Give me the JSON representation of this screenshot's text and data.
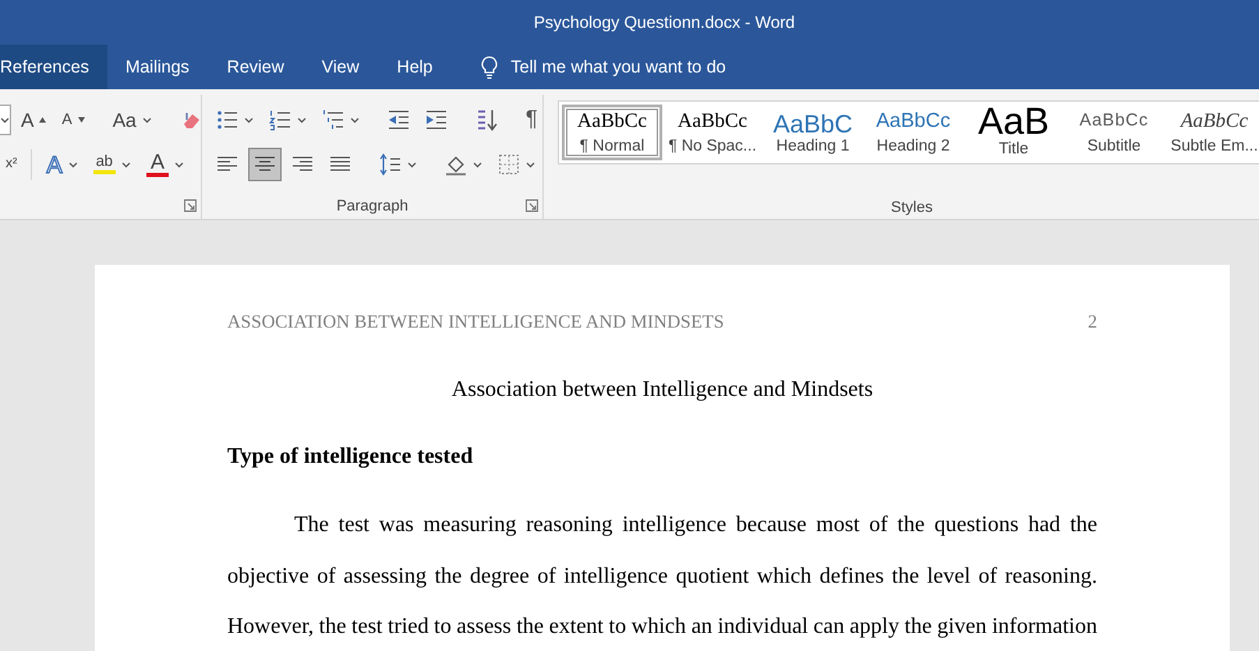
{
  "window": {
    "title": "Psychology Questionn.docx  -  Word"
  },
  "tabs": [
    {
      "label": "References",
      "selected": true
    },
    {
      "label": "Mailings",
      "selected": false
    },
    {
      "label": "Review",
      "selected": false
    },
    {
      "label": "View",
      "selected": false
    },
    {
      "label": "Help",
      "selected": false
    }
  ],
  "tell_me": {
    "placeholder": "Tell me what you want to do"
  },
  "ribbon": {
    "font_group": {
      "rows": [
        [
          {
            "kind": "stub",
            "dropdown": true
          },
          {
            "kind": "glyph",
            "glyph": "A",
            "dropdown": false
          },
          {
            "kind": "glyph",
            "glyph": "A",
            "dropdown": false
          },
          {
            "kind": "divider"
          },
          {
            "kind": "glyph",
            "glyph": "Aa",
            "dropdown": true
          },
          {
            "kind": "divider"
          },
          {
            "kind": "icon",
            "dropdown": false
          }
        ],
        [
          {
            "kind": "glyph",
            "glyph": "x²",
            "dropdown": false
          },
          {
            "kind": "divider"
          },
          {
            "kind": "glyph",
            "glyph": "A",
            "dropdown": true
          },
          {
            "kind": "glyph",
            "glyph": "ab",
            "dropdown": true
          },
          {
            "kind": "glyph",
            "glyph": "A",
            "dropdown": true
          }
        ]
      ]
    },
    "paragraph_group": {
      "label": "Paragraph",
      "rows": [
        [
          {
            "kind": "icon",
            "dropdown": true
          },
          {
            "kind": "icon",
            "dropdown": true
          },
          {
            "kind": "icon",
            "dropdown": true
          },
          {
            "kind": "divider"
          },
          {
            "kind": "icon",
            "dropdown": false
          },
          {
            "kind": "icon",
            "dropdown": false
          },
          {
            "kind": "divider"
          },
          {
            "kind": "icon",
            "dropdown": false
          },
          {
            "kind": "divider"
          },
          {
            "kind": "glyph",
            "glyph": "¶",
            "dropdown": false
          }
        ],
        [
          {
            "kind": "icon",
            "dropdown": false,
            "selected": false
          },
          {
            "kind": "icon",
            "dropdown": false,
            "selected": true
          },
          {
            "kind": "icon",
            "dropdown": false,
            "selected": false
          },
          {
            "kind": "icon",
            "dropdown": false,
            "selected": false
          },
          {
            "kind": "divider"
          },
          {
            "kind": "icon",
            "dropdown": true
          },
          {
            "kind": "divider"
          },
          {
            "kind": "icon",
            "dropdown": true
          },
          {
            "kind": "icon",
            "dropdown": true
          }
        ]
      ]
    },
    "styles_group": {
      "label": "Styles",
      "styles": [
        {
          "preview": "AaBbCc",
          "name": "¶ Normal",
          "kind": "normal",
          "selected": true
        },
        {
          "preview": "AaBbCc",
          "name": "¶ No Spac...",
          "kind": "normal",
          "selected": false
        },
        {
          "preview": "AaBbC",
          "name": "Heading 1",
          "kind": "heading1",
          "selected": false
        },
        {
          "preview": "AaBbCc",
          "name": "Heading 2",
          "kind": "heading2",
          "selected": false
        },
        {
          "preview": "AaB",
          "name": "Title",
          "kind": "title",
          "selected": false
        },
        {
          "preview": "AaBbCc",
          "name": "Subtitle",
          "kind": "subtitle",
          "selected": false
        },
        {
          "preview": "AaBbCc",
          "name": "Subtle Em...",
          "kind": "emphasis",
          "selected": false
        }
      ]
    }
  },
  "document": {
    "header": {
      "running_head": "ASSOCIATION BETWEEN INTELLIGENCE AND MINDSETS",
      "page_number": "2"
    },
    "title": "Association between Intelligence and Mindsets",
    "heading": "Type of intelligence tested",
    "paragraphs": [
      "The test was measuring reasoning intelligence because most of the questions had the objective of assessing the degree of intelligence quotient which defines the level of reasoning. However, the test tried to assess the extent to which an individual can apply the given information"
    ]
  }
}
